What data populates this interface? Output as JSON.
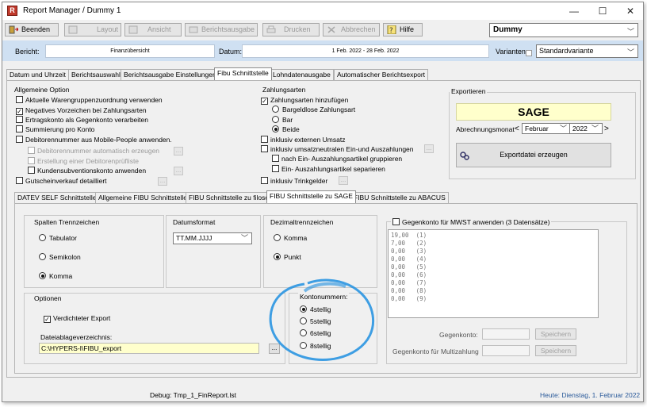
{
  "window": {
    "title": "Report Manager / Dummy 1",
    "minimize": "—",
    "maximize": "☐",
    "close": "✕"
  },
  "toolbar": {
    "beenden": "Beenden",
    "layout": "Layout",
    "ansicht": "Ansicht",
    "berichtsausgabe": "Berichtsausgabe",
    "drucken": "Drucken",
    "abbrechen": "Abbrechen",
    "hilfe": "Hilfe",
    "dummy": "Dummy"
  },
  "header": {
    "bericht_label": "Bericht:",
    "bericht_value": "Finanzübersicht",
    "datum_label": "Datum:",
    "datum_value": "1 Feb. 2022 - 28 Feb. 2022",
    "varianten_label": "Varianten:",
    "varianten_value": "Standardvariante"
  },
  "main_tabs": [
    "Datum und Uhrzeit",
    "Berichtsauswahl",
    "Berichtsausgabe Einstellungen",
    "Fibu Schnittstelle",
    "Lohndatenausgabe",
    "Automatischer Berichtsexport"
  ],
  "main_tab_active": 3,
  "allgemeine": {
    "title": "Allgemeine Option",
    "items": [
      {
        "label": "Aktuelle Warengruppenzuordnung verwenden",
        "checked": false
      },
      {
        "label": "Negatives Vorzeichen bei Zahlungsarten",
        "checked": true
      },
      {
        "label": "Ertragskonto als Gegenkonto verarbeiten",
        "checked": false
      },
      {
        "label": "Summierung pro Konto",
        "checked": false
      },
      {
        "label": "Debitorennummer aus Mobile-People anwenden.",
        "checked": false
      },
      {
        "label": "Debitorennummer automatisch erzeugen",
        "checked": false
      },
      {
        "label": "Erstellung einer Debitorenprüfliste",
        "checked": false
      },
      {
        "label": "Kundensubventionskonto anwenden",
        "checked": false
      },
      {
        "label": "Gutscheinverkauf detailliert",
        "checked": false
      }
    ]
  },
  "zahlungsarten": {
    "title": "Zahlungsarten",
    "hinzufuegen": "Zahlungsarten hinzufügen",
    "radios": [
      "Bargeldlose Zahlungsart",
      "Bar",
      "Beide"
    ],
    "radio_selected": 2,
    "items": [
      "inklusiv externen Umsatz",
      "inklusiv umsatzneutralen Ein-und Auszahlungen",
      "nach Ein- Auszahlungsartikel gruppieren",
      "Ein- Auszahlungsartikel separieren",
      "inklusiv Trinkgelder"
    ]
  },
  "exportieren": {
    "title": "Exportieren",
    "system": "SAGE",
    "abrechnungsmonat_label": "Abrechnungsmonat",
    "month": "Februar",
    "year": "2022",
    "prev": "<",
    "next": ">",
    "button": "Exportdatei erzeugen"
  },
  "sub_tabs": [
    "DATEV SELF Schnittstelle",
    "Allgemeine FIBU Schnittstelle",
    "FIBU Schnittstelle zu filosof",
    "FIBU Schnittstelle zu SAGE",
    "FIBU Schnittstelle zu ABACUS"
  ],
  "sub_tab_active": 3,
  "spalten": {
    "title": "Spalten Trennzeichen",
    "options": [
      "Tabulator",
      "Semikolon",
      "Komma"
    ],
    "selected": 2
  },
  "datumsformat": {
    "title": "Datumsformat",
    "value": "TT.MM.JJJJ"
  },
  "dezimal": {
    "title": "Dezimaltrennzeichen",
    "options": [
      "Komma",
      "Punkt"
    ],
    "selected": 1
  },
  "optionen": {
    "title": "Optionen",
    "verdichteter": "Verdichteter Export",
    "verdichteter_checked": true,
    "dateiablage_label": "Dateiablageverzeichnis:",
    "dateiablage_value": "C:\\HYPERS-I\\FIBU_export",
    "browse": "..."
  },
  "kontonummern": {
    "title": "Kontonummern:",
    "options": [
      "4stellig",
      "5stellig",
      "6stellig",
      "8stellig"
    ],
    "selected": 0
  },
  "mwst": {
    "label": "Gegenkonto für MWST anwenden (3 Datensätze)",
    "rows": [
      "19,00  (1)",
      "7,00   (2)",
      "0,00   (3)",
      "0,00   (4)",
      "0,00   (5)",
      "0,00   (6)",
      "0,00   (7)",
      "0,00   (8)",
      "0,00   (9)"
    ],
    "gegenkonto_label": "Gegenkonto:",
    "multizahlung_label": "Gegenkonto für Multizahlung",
    "speichern": "Speichern"
  },
  "status": {
    "debug": "Debug: Tmp_1_FinReport.lst",
    "heute": "Heute: Dienstag, 1. Februar 2022"
  }
}
